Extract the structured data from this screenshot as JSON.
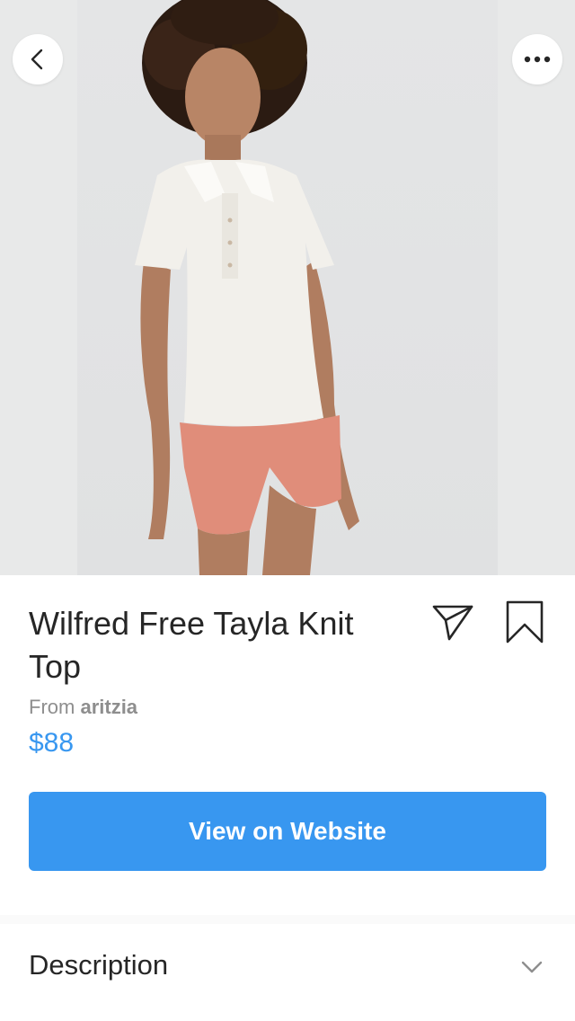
{
  "product": {
    "title": "Wilfred Free Tayla Knit Top",
    "from_prefix": "From ",
    "brand": "aritzia",
    "price": "$88"
  },
  "actions": {
    "view_website_label": "View on Website"
  },
  "description": {
    "label": "Description"
  },
  "icons": {
    "back": "chevron-left-icon",
    "more": "more-horizontal-icon",
    "share": "paper-plane-icon",
    "save": "bookmark-icon",
    "expand": "chevron-down-icon"
  },
  "colors": {
    "accent": "#3897f0",
    "text_primary": "#262626",
    "text_secondary": "#8e8e8e"
  }
}
